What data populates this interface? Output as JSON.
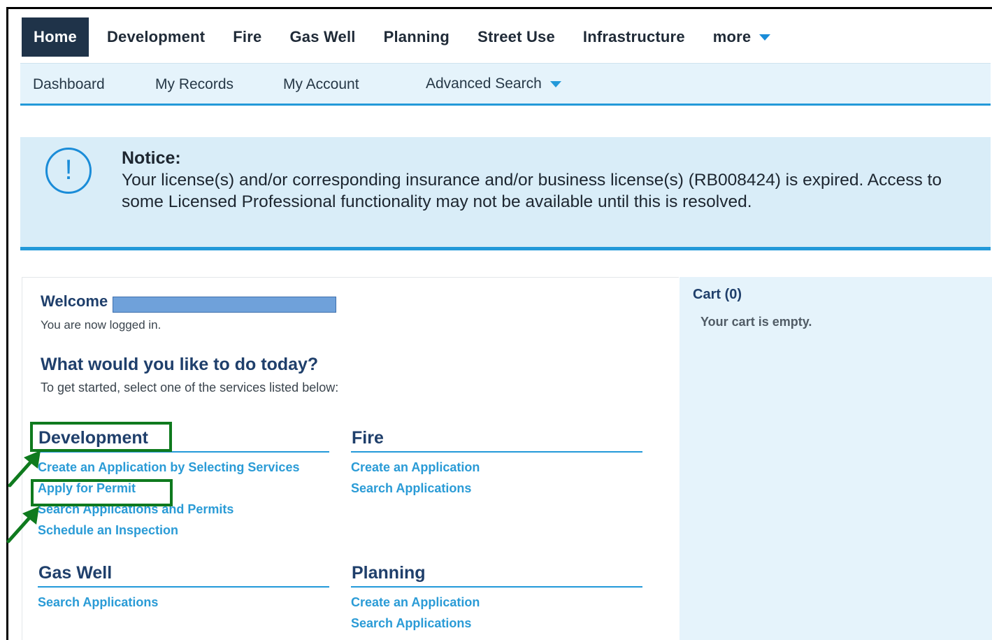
{
  "topnav": {
    "tabs": [
      {
        "label": "Home",
        "active": true
      },
      {
        "label": "Development"
      },
      {
        "label": "Fire"
      },
      {
        "label": "Gas Well"
      },
      {
        "label": "Planning"
      },
      {
        "label": "Street Use"
      },
      {
        "label": "Infrastructure"
      },
      {
        "label": "more"
      }
    ]
  },
  "subnav": {
    "items": [
      "Dashboard",
      "My Records",
      "My Account",
      "Advanced Search"
    ]
  },
  "notice": {
    "title": "Notice:",
    "message": "Your license(s) and/or corresponding insurance and/or business license(s) (RB008424) is expired. Access to some Licensed Professional functionality may not be available until this is resolved.",
    "icon": "exclamation-circle-icon"
  },
  "main": {
    "welcome": "Welcome",
    "logged_in": "You are now logged in.",
    "question": "What would you like to do today?",
    "instructions": "To get started, select one of the services listed below:",
    "sections": [
      {
        "title": "Development",
        "links": [
          "Create an Application by Selecting Services",
          "Apply for Permit",
          "Search Applications and Permits",
          "Schedule an Inspection"
        ]
      },
      {
        "title": "Fire",
        "links": [
          "Create an Application",
          "Search Applications"
        ]
      },
      {
        "title": "Gas Well",
        "links": [
          "Search Applications"
        ]
      },
      {
        "title": "Planning",
        "links": [
          "Create an Application",
          "Search Applications"
        ]
      }
    ]
  },
  "cart": {
    "title": "Cart (0)",
    "empty": "Your cart is empty."
  },
  "colors": {
    "nav_dark": "#1f3349",
    "accent_blue": "#2399d9",
    "link_blue": "#2a9bd6",
    "heading_navy": "#1f3f6b",
    "highlight_green": "#0f7a1e"
  }
}
